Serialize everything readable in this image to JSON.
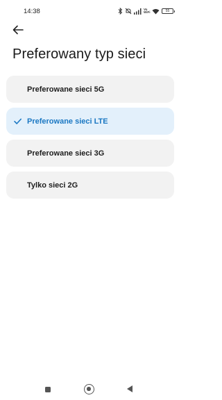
{
  "status_bar": {
    "time": "14:38",
    "icons": [
      "bluetooth-icon",
      "mute-icon",
      "signal-icon",
      "volte-icon",
      "wifi-icon",
      "battery-icon"
    ],
    "volte_label": "Vo WiFi",
    "battery_level": "55"
  },
  "header": {
    "back_icon": "arrow-left-icon",
    "title": "Preferowany typ sieci"
  },
  "options": [
    {
      "label": "Preferowane sieci 5G",
      "selected": false
    },
    {
      "label": "Preferowane sieci LTE",
      "selected": true
    },
    {
      "label": "Preferowane sieci 3G",
      "selected": false
    },
    {
      "label": "Tylko sieci 2G",
      "selected": false
    }
  ],
  "colors": {
    "accent": "#1b78c3",
    "selected_bg": "#e3f0fb",
    "option_bg": "#f2f2f2"
  },
  "nav_bar": {
    "icons": [
      "recents-icon",
      "home-icon",
      "back-icon"
    ]
  }
}
